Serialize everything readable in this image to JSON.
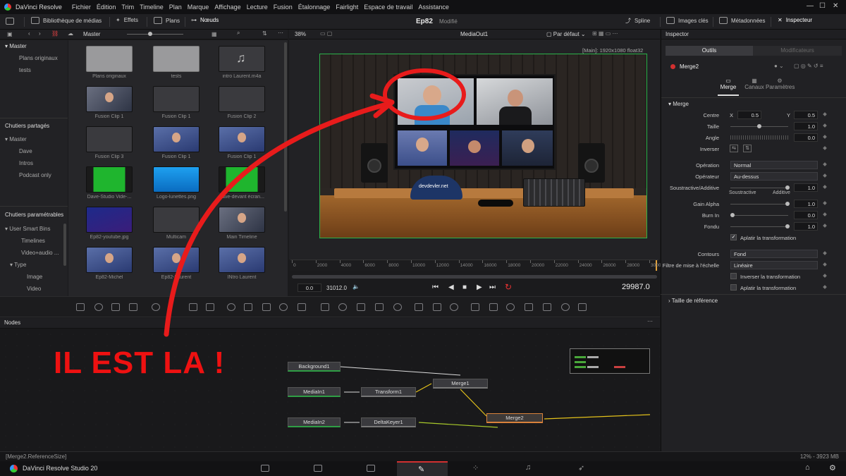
{
  "app": {
    "title": "DaVinci Resolve",
    "brand": "DaVinci Resolve Studio 20"
  },
  "menu": [
    "Fichier",
    "Édition",
    "Trim",
    "Timeline",
    "Plan",
    "Marque",
    "Affichage",
    "Lecture",
    "Fusion",
    "Étalonnage",
    "Fairlight",
    "Espace de travail",
    "Assistance"
  ],
  "toolbar": {
    "media_lib": "Bibliothèque de médias",
    "effects": "Effets",
    "clips": "Plans",
    "nodes": "Nœuds",
    "project": "Ep82",
    "modified": "Modifié",
    "spline": "Spline",
    "keyframes": "Images clés",
    "metadata": "Métadonnées",
    "inspector": "Inspecteur"
  },
  "media_pool": {
    "header": "Master",
    "zoom": "38%",
    "bins": {
      "master": "Master",
      "items": [
        "Plans originaux",
        "tests"
      ],
      "shared_title": "Chutiers partagés",
      "shared": [
        "Master",
        "Dave",
        "Intros",
        "Podcast only"
      ],
      "smart_title": "Chutiers paramétrables",
      "smart": [
        "User Smart Bins",
        "Timelines",
        "Video+audio ...",
        "Type",
        "Image",
        "Video"
      ]
    },
    "clips": [
      {
        "name": "Plans originaux",
        "kind": "folder"
      },
      {
        "name": "tests",
        "kind": "folder"
      },
      {
        "name": "intro Laurent.m4a",
        "kind": "audio"
      },
      {
        "name": "Fusion Clip 1",
        "kind": "multi"
      },
      {
        "name": "Fusion Clip 1",
        "kind": "dark"
      },
      {
        "name": "Fusion Clip 2",
        "kind": "dark"
      },
      {
        "name": "Fusion Clip 3",
        "kind": "dark"
      },
      {
        "name": "Fusion Clip 1",
        "kind": "person"
      },
      {
        "name": "Fusion Clip 1",
        "kind": "person"
      },
      {
        "name": "Dave-Studio Vide-...",
        "kind": "green"
      },
      {
        "name": "Logo-lunettes.png",
        "kind": "logo"
      },
      {
        "name": "dave-devant écran...",
        "kind": "green"
      },
      {
        "name": "Ep82-youtube.jpg",
        "kind": "slide"
      },
      {
        "name": "Multicam",
        "kind": "dark"
      },
      {
        "name": "Main Timeline",
        "kind": "multi"
      },
      {
        "name": "Ep82-Michel",
        "kind": "person"
      },
      {
        "name": "Ep82-Laurent",
        "kind": "person"
      },
      {
        "name": "INtro Laurent",
        "kind": "person"
      }
    ]
  },
  "viewer": {
    "title": "MediaOut1",
    "mode": "Par défaut",
    "info": "[Main]: 1920x1080 float32",
    "cap_text": "devdevler.net",
    "timecode_start": "0.0",
    "frame_end": "31012.0",
    "current_frame": "29987.0",
    "ruler": [
      "0",
      "2000",
      "4000",
      "6000",
      "8000",
      "10000",
      "12000",
      "14000",
      "16000",
      "18000",
      "20000",
      "22000",
      "24000",
      "26000",
      "28000",
      "3000"
    ]
  },
  "nodes_panel": {
    "title": "Nodes",
    "nodes": [
      "Background1",
      "MediaIn1",
      "Transform1",
      "Merge1",
      "MediaIn2",
      "DeltaKeyer1",
      "Merge2"
    ]
  },
  "inspector": {
    "title": "Inspector",
    "tab_tools": "Outils",
    "tab_modifiers": "Modificateurs",
    "node_name": "Merge2",
    "subtabs": [
      "Merge",
      "Canaux",
      "Paramètres"
    ],
    "section": "Merge",
    "centre_label": "Centre",
    "centre_x_label": "X",
    "centre_x": "0.5",
    "centre_y_label": "Y",
    "centre_y": "0.5",
    "size_label": "Taille",
    "size": "1.0",
    "angle_label": "Angle",
    "angle": "0.0",
    "flip_label": "Inverser",
    "apply_label": "Opération",
    "apply_value": "Normal",
    "operator_label": "Opérateur",
    "operator_value": "Au-dessus",
    "subadd_label": "Soustractive/Additive",
    "subadd": "1.0",
    "subtractive": "Soustractive",
    "additive": "Additive",
    "gain_label": "Gain Alpha",
    "gain": "1.0",
    "burn_label": "Burn In",
    "burn": "0.0",
    "blend_label": "Fondu",
    "blend": "1.0",
    "flatten": "Aplatir la transformation",
    "edges_label": "Contours",
    "edges_value": "Fond",
    "filter_label": "Filtre de mise à l'échelle",
    "filter_value": "Linéaire",
    "invert_transform": "Inverser la transformation",
    "flatten2": "Aplatir la transformation",
    "ref_size": "Taille de référence"
  },
  "status": {
    "left": "[Merge2.ReferenceSize]",
    "right": "12% - 3923 MB"
  },
  "annotation": "IL EST LA !",
  "colors": {
    "accent_red": "#e81b1b",
    "node_green": "#2f9e45",
    "selected_node": "#d9823b"
  }
}
